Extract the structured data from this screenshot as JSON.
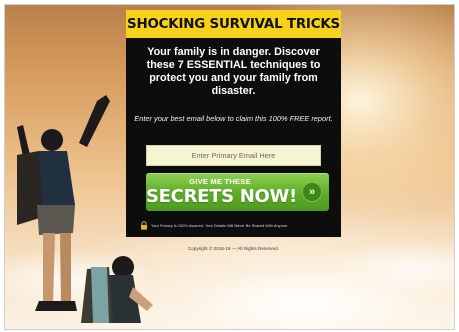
{
  "optin": {
    "headline": "SHOCKING SURVIVAL TRICKS",
    "subhead": "Your family is in danger. Discover these 7 ESSENTIAL techniques to protect you and your family from disaster.",
    "instruction": "Enter your best email below to claim this 100% FREE report.",
    "email_placeholder": "Enter Primary Email Here",
    "cta_small": "GIVE ME THESE",
    "cta_big": "SECRETS NOW!",
    "cta_arrow": "»",
    "privacy": "Your Privacy Is 100% Assured. Your Details Will Never Be Shared With Anyone."
  },
  "footer": {
    "copyright": "Copyright © 2015-16 — All Rights Reserved."
  },
  "colors": {
    "headline_bar": "#f7d21a",
    "panel": "#0d0d0d",
    "cta_green": "#5fad2a"
  },
  "icons": [
    "lock-icon",
    "double-chevron-right-icon"
  ]
}
